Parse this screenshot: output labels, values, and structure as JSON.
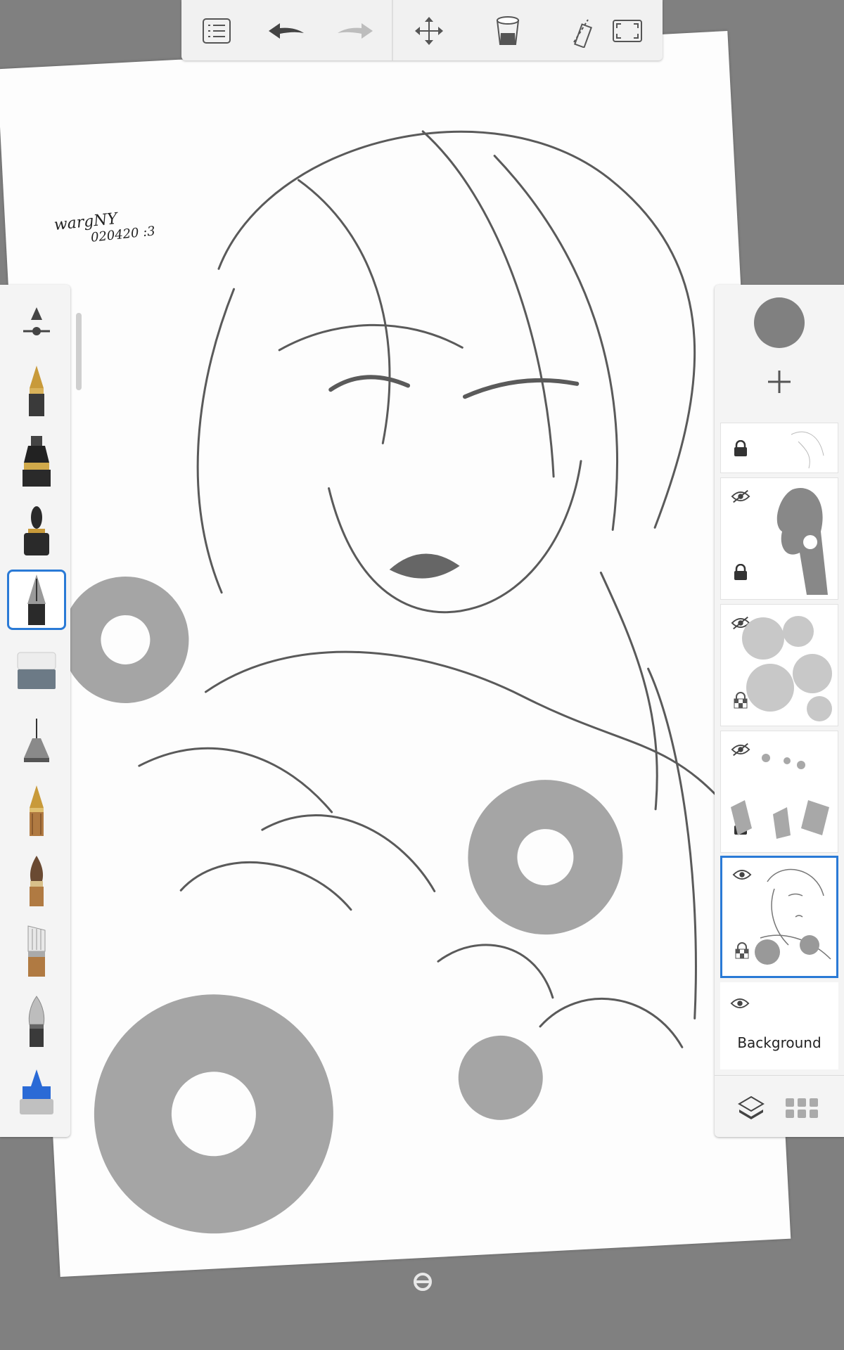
{
  "canvas": {
    "signature_text": "wargNY",
    "signature_date": "020420 :3"
  },
  "toolbar": {
    "buttons": [
      {
        "name": "list-icon"
      },
      {
        "name": "undo-icon"
      },
      {
        "name": "redo-icon"
      },
      {
        "name": "transform-move-icon"
      },
      {
        "name": "bucket-fill-icon"
      },
      {
        "name": "ruler-icon"
      },
      {
        "name": "fullscreen-icon"
      }
    ]
  },
  "brushes": [
    {
      "name": "brush-size-slider-icon"
    },
    {
      "name": "fountain-pen-gold-icon"
    },
    {
      "name": "ink-pen-icon"
    },
    {
      "name": "marker-icon"
    },
    {
      "name": "fineliner-pen-icon",
      "selected": true
    },
    {
      "name": "eraser-icon"
    },
    {
      "name": "airbrush-icon"
    },
    {
      "name": "pencil-icon"
    },
    {
      "name": "paint-brush-icon"
    },
    {
      "name": "flat-brush-icon"
    },
    {
      "name": "smudge-icon"
    },
    {
      "name": "fill-marker-icon"
    }
  ],
  "layers": {
    "current_color": "#808080",
    "items": [
      {
        "id": "layer-1",
        "visible": true,
        "locked": true
      },
      {
        "id": "layer-2",
        "visible": false,
        "locked": true
      },
      {
        "id": "layer-3",
        "visible": false,
        "locked": false
      },
      {
        "id": "layer-4",
        "visible": false,
        "locked": true
      },
      {
        "id": "layer-5",
        "visible": true,
        "locked": false,
        "active": true
      },
      {
        "id": "background",
        "visible": true,
        "label": "Background"
      }
    ],
    "background_label": "Background"
  },
  "accent_color": "#2a7ad6"
}
